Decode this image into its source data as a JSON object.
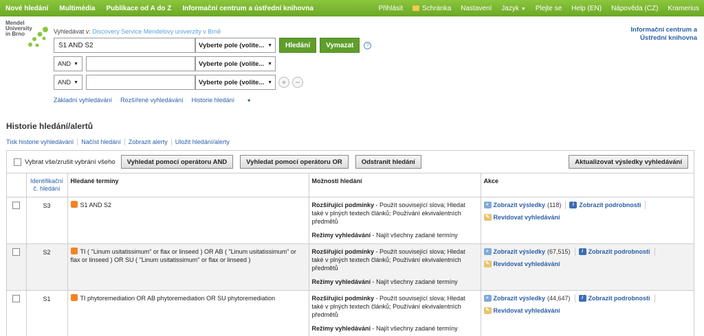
{
  "topnav": {
    "left": [
      "Nové hledání",
      "Multimédia",
      "Publikace od A do Z",
      "Informační centrum a ústřední knihovna"
    ],
    "right": {
      "signin": "Přihlásit",
      "folder": "Schránka",
      "settings": "Nastavení",
      "language": "Jazyk",
      "feedback": "Plejte se",
      "help_en": "Help (EN)",
      "help_cz": "Nápověda (CZ)",
      "kramerius": "Kramerius"
    }
  },
  "logo": {
    "line1": "Mendel",
    "line2": "University",
    "line3": "in Brno"
  },
  "search": {
    "search_in_label": "Vyhledávat v:",
    "search_in_db": "Discovery Service Mendelovy univerzity v Brně",
    "row1_value": "S1 AND S2",
    "field_select": "Vyberte pole (volite...",
    "search_button": "Hledání",
    "clear_button": "Vymazat",
    "help": "?",
    "op2": "AND",
    "op3": "AND",
    "row2_value": "",
    "row3_value": "",
    "add": "+",
    "remove": "−",
    "links": {
      "basic": "Základní vyhledávání",
      "advanced": "Rozšířené vyhledávání",
      "history": "Historie hledání"
    }
  },
  "library_link": "Informační centrum a Ústřední knihovna",
  "history": {
    "title": "Historie hledání/alertů",
    "links": [
      "Tisk historie vyhledávání",
      "Načíst hledání",
      "Zobrazit alerty",
      "Uložit hledání/alerty"
    ],
    "toolbar": {
      "select_all": "Vybrat vše/zrušit vybrání všeho",
      "and_button": "Vyhledat pomocí operátoru AND",
      "or_button": "Vyhledat pomocí operátoru OR",
      "remove_button": "Odstranit hledání",
      "refresh_button": "Aktualizovat výsledky vyhledávání"
    },
    "headers": {
      "id": "Identifikační č. hledání",
      "terms": "Hledané termíny",
      "options": "Možnosti hledání",
      "actions": "Akce"
    },
    "rows": [
      {
        "id": "S3",
        "terms": "S1 AND S2",
        "exp_label": "Rozšiřující podmínky",
        "exp_text": " - Použít související slova; Hledat také v plných textech článků; Používání ekvivalentních předmětů",
        "mode_label": "Režimy vyhledávání",
        "mode_text": " - Najít všechny zadané termíny",
        "view": "Zobrazit výsledky",
        "count": "(118)",
        "details": "Zobrazit podrobnosti",
        "revise": "Revidovat vyhledávání"
      },
      {
        "id": "S2",
        "terms": "TI ( \"Linum usitatissimum\" or flax or linseed ) OR AB ( \"Linum usitatissimum\" or flax or linseed ) OR SU ( \"Linum usitatissimum\" or flax or linseed )",
        "exp_label": "Rozšiřující podmínky",
        "exp_text": " - Použít související slova; Hledat také v plných textech článků; Používání ekvivalentních předmětů",
        "mode_label": "Režimy vyhledávání",
        "mode_text": " - Najít všechny zadané termíny",
        "view": "Zobrazit výsledky",
        "count": "(67,515)",
        "details": "Zobrazit podrobnosti",
        "revise": "Revidovat vyhledávání"
      },
      {
        "id": "S1",
        "terms": "TI phytoremediation OR AB phytoremediation OR SU phytoremediation",
        "exp_label": "Rozšiřující podmínky",
        "exp_text": " - Použít související slova; Hledat také v plných textech článků; Používání ekvivalentních předmětů",
        "mode_label": "Režimy vyhledávání",
        "mode_text": " - Najít všechny zadané termíny",
        "view": "Zobrazit výsledky",
        "count": "(44,647)",
        "details": "Zobrazit podrobnosti",
        "revise": "Revidovat vyhledávání"
      }
    ]
  },
  "colors": {
    "topbar": "#6aa825",
    "accent_green": "#5f9e2b",
    "link": "#2a5fa8"
  }
}
